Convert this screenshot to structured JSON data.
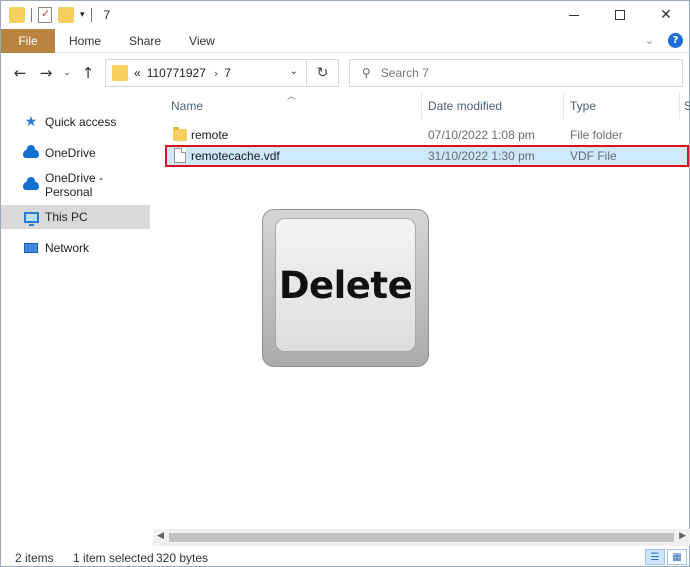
{
  "window": {
    "title": "7",
    "controls": {
      "minimize": "",
      "maximize": "",
      "close": "✕"
    }
  },
  "ribbon": {
    "tabs": [
      "File",
      "Home",
      "Share",
      "View"
    ],
    "accent_color": "#b8843f"
  },
  "navigation": {
    "back": "←",
    "forward": "→",
    "recent": "⌄",
    "up": "↑"
  },
  "address": {
    "overflow": "«",
    "segments": [
      "110771927",
      "7"
    ],
    "separator": "›",
    "dropdown": "⌄",
    "refresh": "↻"
  },
  "search": {
    "placeholder": "Search 7"
  },
  "sidebar": {
    "items": [
      {
        "label": "Quick access",
        "icon": "star-icon"
      },
      {
        "label": "OneDrive",
        "icon": "cloud-icon"
      },
      {
        "label": "OneDrive - Personal",
        "icon": "cloud-icon"
      },
      {
        "label": "This PC",
        "icon": "computer-icon",
        "selected": true
      },
      {
        "label": "Network",
        "icon": "network-icon"
      }
    ]
  },
  "columns": {
    "name": "Name",
    "date": "Date modified",
    "type": "Type",
    "extra": "S"
  },
  "files": [
    {
      "name": "remote",
      "date": "07/10/2022 1:08 pm",
      "type": "File folder",
      "icon": "folder-icon"
    },
    {
      "name": "remotecache.vdf",
      "date": "31/10/2022 1:30 pm",
      "type": "VDF File",
      "icon": "file-icon",
      "selected": true
    }
  ],
  "overlay": {
    "key_label": "Delete"
  },
  "status": {
    "item_count": "2 items",
    "selection": "1 item selected",
    "size": "320 bytes"
  },
  "colors": {
    "selection_bg": "#cde8ff",
    "highlight_border": "#d7141e",
    "sidebar_selected": "#d9d9d9"
  }
}
